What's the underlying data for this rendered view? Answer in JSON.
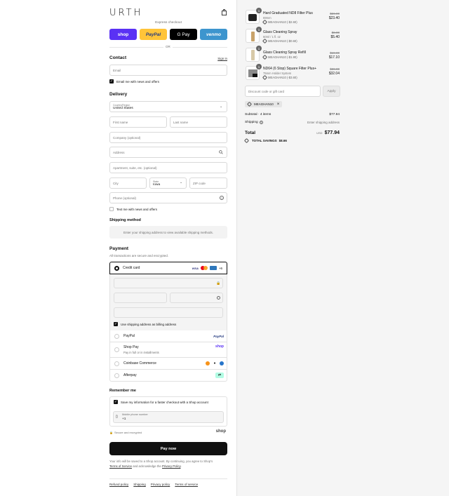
{
  "header": {
    "logo": "URTH",
    "express_checkout": "Express checkout",
    "or": "OR"
  },
  "express": [
    {
      "label": "shop",
      "bg": "#5a31f4",
      "color": "#fff"
    },
    {
      "label": "PayPal",
      "bg": "#ffc439",
      "color": "#253b80"
    },
    {
      "label": "G Pay",
      "bg": "#000000",
      "color": "#fff"
    },
    {
      "label": "venmo",
      "bg": "#3d95ce",
      "color": "#fff"
    }
  ],
  "contact": {
    "title": "Contact",
    "sign_in": "Sign in",
    "email_placeholder": "Email",
    "news_label": "Email me with news and offers"
  },
  "delivery": {
    "title": "Delivery",
    "country_label": "Country/Region",
    "country_value": "United States",
    "first_name": "First name",
    "last_name": "Last name",
    "company": "Company (optional)",
    "address": "Address",
    "apartment": "Apartment, suite, etc. (optional)",
    "city": "City",
    "state_label": "State",
    "state_value": "Iowa",
    "zip": "ZIP code",
    "phone": "Phone (optional)",
    "text_label": "Text me with news and offers"
  },
  "shipping": {
    "title": "Shipping method",
    "note": "Enter your shipping address to view available shipping methods."
  },
  "payment": {
    "title": "Payment",
    "subtitle": "All transactions are secure and encrypted.",
    "credit_card": "Credit card",
    "more_cards": "+6",
    "billing_label": "Use shipping address as billing address",
    "paypal": "PayPal",
    "paypal_logo": "PayPal",
    "shop_pay": "Shop Pay",
    "shop_pay_sub": "Pay in full or in installments",
    "shop_logo": "shop",
    "coinbase": "Coinbase Commerce",
    "afterpay": "Afterpay"
  },
  "remember": {
    "title": "Remember me",
    "save_label": "Save my information for a faster checkout with a Shop account",
    "mobile_label": "Mobile phone number",
    "mobile_value": "+1",
    "secure": "Secure and encrypted",
    "shop_logo": "shop"
  },
  "pay_now": "Pay now",
  "legal": {
    "text1": "Your info will be saved to a Shop account. By continuing, you agree to Shop's",
    "terms": "Terms of Service",
    "and": " and acknowledge the ",
    "privacy": "Privacy Policy",
    "period": "."
  },
  "footer_links": [
    "Refund policy",
    "Shipping",
    "Privacy policy",
    "Terms of service"
  ],
  "cart": {
    "items": [
      {
        "qty": "1",
        "name": "Hard Graduated ND8 Filter Plus",
        "variant": "69mm",
        "discount": "MEAGHAN10 (-$2.60)",
        "old_price": "$26.00",
        "price": "$23.40"
      },
      {
        "qty": "1",
        "name": "Glass Cleaning Spray",
        "variant": "60ml / 1 fl. oz",
        "discount": "MEAGHAN10 (-$0.60)",
        "old_price": "$6.00",
        "price": "$5.40"
      },
      {
        "qty": "1",
        "name": "Glass Cleaning Spray Refill",
        "variant": "",
        "discount": "MEAGHAN10 (-$1.90)",
        "old_price": "$19.00",
        "price": "$17.10"
      },
      {
        "qty": "1",
        "name": "ND64 (6 Stop) Square Filter Plus+",
        "variant": "75mm Holder System",
        "discount": "MEAGHAN10 (-$3.60)",
        "old_price": "$36.00",
        "price": "$32.04"
      }
    ],
    "discount_placeholder": "Discount code or gift card",
    "apply": "Apply",
    "applied_code": "MEAGHAN10",
    "subtotal_label": "Subtotal · 4 items",
    "subtotal_value": "$77.94",
    "shipping_label": "Shipping",
    "shipping_value": "Enter shipping address",
    "total_label": "Total",
    "currency": "USD",
    "total_value": "$77.94",
    "savings_label": "TOTAL SAVINGS",
    "savings_value": "$8.66"
  }
}
